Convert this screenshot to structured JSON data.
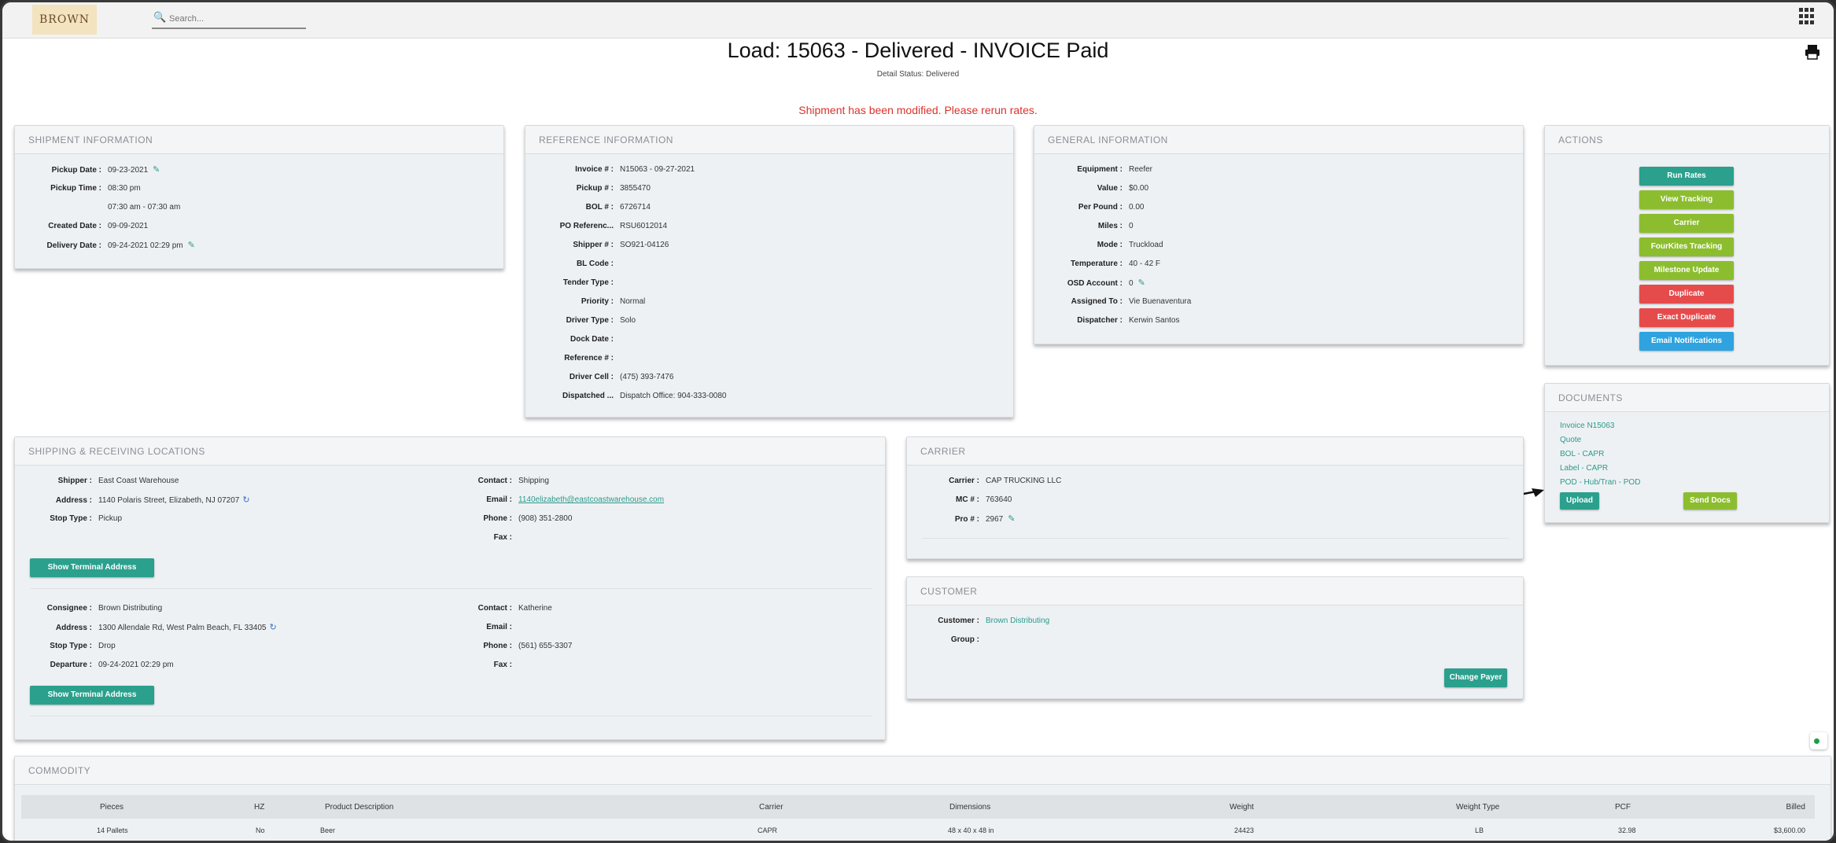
{
  "app": {
    "logo_text": "BROWN",
    "search_placeholder": "Search..."
  },
  "header": {
    "title": "Load: 15063 - Delivered - INVOICE Paid",
    "detail_status": "Detail Status: Delivered",
    "alert": "Shipment has been modified. Please rerun rates."
  },
  "shipment": {
    "title": "SHIPMENT INFORMATION",
    "rows": [
      {
        "label": "Pickup Date :",
        "value": "09-23-2021"
      },
      {
        "label": "Pickup Time :",
        "value": "08:30 pm"
      },
      {
        "label": "",
        "value": "07:30 am - 07:30 am"
      },
      {
        "label": "Created Date :",
        "value": "09-09-2021"
      },
      {
        "label": "Delivery Date :",
        "value": "09-24-2021 02:29 pm"
      }
    ]
  },
  "reference": {
    "title": "REFERENCE INFORMATION",
    "rows": [
      {
        "label": "Invoice # :",
        "value": "N15063 - 09-27-2021"
      },
      {
        "label": "Pickup # :",
        "value": "3855470"
      },
      {
        "label": "BOL # :",
        "value": "6726714"
      },
      {
        "label": "PO Referenc...",
        "value": "RSU6012014"
      },
      {
        "label": "Shipper # :",
        "value": "SO921-04126"
      },
      {
        "label": "BL Code :",
        "value": ""
      },
      {
        "label": "Tender Type :",
        "value": ""
      },
      {
        "label": "Priority :",
        "value": "Normal"
      },
      {
        "label": "Driver Type :",
        "value": "Solo"
      },
      {
        "label": "Dock Date :",
        "value": ""
      },
      {
        "label": "Reference # :",
        "value": ""
      },
      {
        "label": "Driver Cell :",
        "value": "(475) 393-7476"
      },
      {
        "label": "Dispatched ...",
        "value": "Dispatch Office: 904-333-0080"
      }
    ]
  },
  "general": {
    "title": "GENERAL INFORMATION",
    "rows": [
      {
        "label": "Equipment :",
        "value": "Reefer"
      },
      {
        "label": "Value :",
        "value": "$0.00"
      },
      {
        "label": "Per Pound :",
        "value": "0.00"
      },
      {
        "label": "Miles :",
        "value": "0"
      },
      {
        "label": "Mode :",
        "value": "Truckload"
      },
      {
        "label": "Temperature :",
        "value": "40 - 42 F"
      },
      {
        "label": "OSD Account :",
        "value": "0"
      },
      {
        "label": "Assigned To :",
        "value": "Vie Buenaventura"
      },
      {
        "label": "Dispatcher :",
        "value": "Kerwin Santos"
      }
    ]
  },
  "actions": {
    "title": "ACTIONS",
    "buttons": [
      {
        "label": "Run Rates",
        "color": "#2aa08d"
      },
      {
        "label": "View Tracking",
        "color": "#8cbd2f"
      },
      {
        "label": "Carrier",
        "color": "#8cbd2f"
      },
      {
        "label": "FourKites Tracking",
        "color": "#8cbd2f"
      },
      {
        "label": "Milestone Update",
        "color": "#8cbd2f"
      },
      {
        "label": "Duplicate",
        "color": "#e64b4b"
      },
      {
        "label": "Exact Duplicate",
        "color": "#e64b4b"
      },
      {
        "label": "Email Notifications",
        "color": "#2ea3df"
      }
    ]
  },
  "documents": {
    "title": "DOCUMENTS",
    "links": [
      "Invoice N15063",
      "Quote",
      "BOL - CAPR",
      "Label - CAPR",
      "POD - Hub/Tran - POD"
    ],
    "upload_label": "Upload",
    "send_docs_label": "Send Docs"
  },
  "locations": {
    "title": "SHIPPING & RECEIVING LOCATIONS",
    "shipper": {
      "shipper_label": "Shipper :",
      "shipper_value": "East Coast Warehouse",
      "address_label": "Address :",
      "address_value": "1140 Polaris Street, Elizabeth, NJ 07207",
      "stop_label": "Stop Type :",
      "stop_value": "Pickup",
      "contact_label": "Contact :",
      "contact_value": "Shipping",
      "email_label": "Email :",
      "email_value": "1140elizabeth@eastcoastwarehouse.com",
      "phone_label": "Phone :",
      "phone_value": "(908) 351-2800",
      "fax_label": "Fax :",
      "fax_value": ""
    },
    "consignee": {
      "consignee_label": "Consignee :",
      "consignee_value": "Brown Distributing",
      "address_label": "Address :",
      "address_value": "1300 Allendale Rd, West Palm Beach, FL 33405",
      "stop_label": "Stop Type :",
      "stop_value": "Drop",
      "departure_label": "Departure :",
      "departure_value": "09-24-2021 02:29 pm",
      "contact_label": "Contact :",
      "contact_value": "Katherine",
      "email_label": "Email :",
      "email_value": "",
      "phone_label": "Phone :",
      "phone_value": "(561) 655-3307",
      "fax_label": "Fax :",
      "fax_value": ""
    },
    "terminal_button": "Show Terminal Address"
  },
  "carrier": {
    "title": "CARRIER",
    "carrier_label": "Carrier :",
    "carrier_value": "CAP TRUCKING LLC",
    "mc_label": "MC # :",
    "mc_value": "763640",
    "pro_label": "Pro # :",
    "pro_value": "2967"
  },
  "customer": {
    "title": "CUSTOMER",
    "customer_label": "Customer :",
    "customer_value": "Brown Distributing",
    "group_label": "Group :",
    "group_value": "",
    "change_payer_label": "Change Payer"
  },
  "commodity": {
    "title": "COMMODITY",
    "columns": [
      "Pieces",
      "HZ",
      "Product Description",
      "Carrier",
      "Dimensions",
      "Weight",
      "Weight Type",
      "PCF",
      "Billed"
    ],
    "rows": [
      [
        "14 Pallets",
        "No",
        "Beer",
        "CAPR",
        "48 x 40 x 48 in",
        "24423",
        "LB",
        "32.98",
        "$3,600.00"
      ]
    ]
  },
  "colors": {
    "accent": "#2aa08d",
    "alert": "#d9322b",
    "green_btn": "#8cbd2f",
    "red_btn": "#e64b4b",
    "blue_btn": "#2ea3df"
  }
}
